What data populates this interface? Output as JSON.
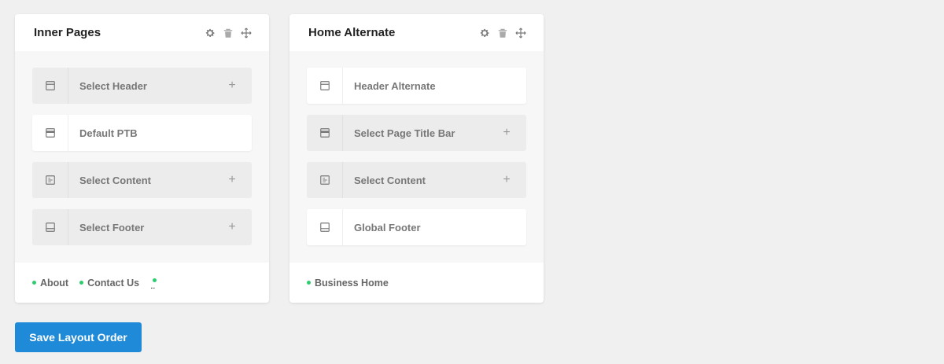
{
  "cards": [
    {
      "title": "Inner Pages",
      "slots": [
        {
          "label": "Select Header",
          "icon": "header-icon",
          "state": "empty",
          "plus": "+"
        },
        {
          "label": "Default PTB",
          "icon": "title-bar-icon",
          "state": "filled",
          "plus": ""
        },
        {
          "label": "Select Content",
          "icon": "content-icon",
          "state": "empty",
          "plus": "+"
        },
        {
          "label": "Select Footer",
          "icon": "footer-icon",
          "state": "empty",
          "plus": "+"
        }
      ],
      "pages": [
        "About",
        "Contact Us"
      ],
      "more_indicator": "..."
    },
    {
      "title": "Home Alternate",
      "slots": [
        {
          "label": "Header Alternate",
          "icon": "header-icon",
          "state": "filled",
          "plus": ""
        },
        {
          "label": "Select Page Title Bar",
          "icon": "title-bar-icon",
          "state": "empty",
          "plus": "+"
        },
        {
          "label": "Select Content",
          "icon": "content-icon",
          "state": "empty",
          "plus": "+"
        },
        {
          "label": "Global Footer",
          "icon": "footer-icon",
          "state": "filled",
          "plus": ""
        }
      ],
      "pages": [
        "Business Home"
      ]
    }
  ],
  "save_button": "Save Layout Order",
  "colors": {
    "accent": "#1f8ad8",
    "page_dot": "#2ecc71",
    "background": "#f0f0f0"
  }
}
